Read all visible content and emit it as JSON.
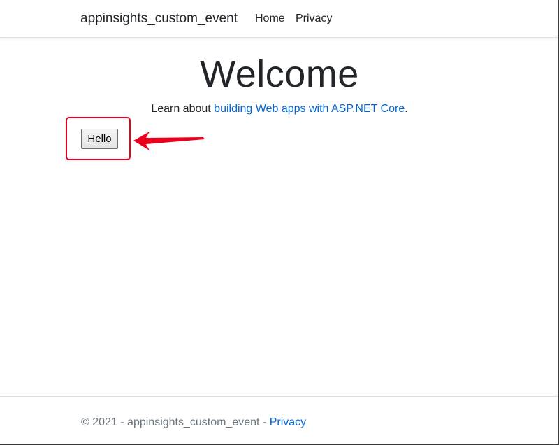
{
  "navbar": {
    "brand": "appinsights_custom_event",
    "links": [
      {
        "label": "Home"
      },
      {
        "label": "Privacy"
      }
    ]
  },
  "main": {
    "title": "Welcome",
    "learn_prefix": "Learn about ",
    "learn_link": "building Web apps with ASP.NET Core",
    "learn_suffix": ".",
    "hello_button": "Hello"
  },
  "annotation": {
    "color": "#e8001c"
  },
  "footer": {
    "copyright": "© 2021 - appinsights_custom_event - ",
    "privacy_link": "Privacy"
  },
  "colors": {
    "link": "#0366d6",
    "text": "#212529",
    "muted": "#6c757d"
  }
}
